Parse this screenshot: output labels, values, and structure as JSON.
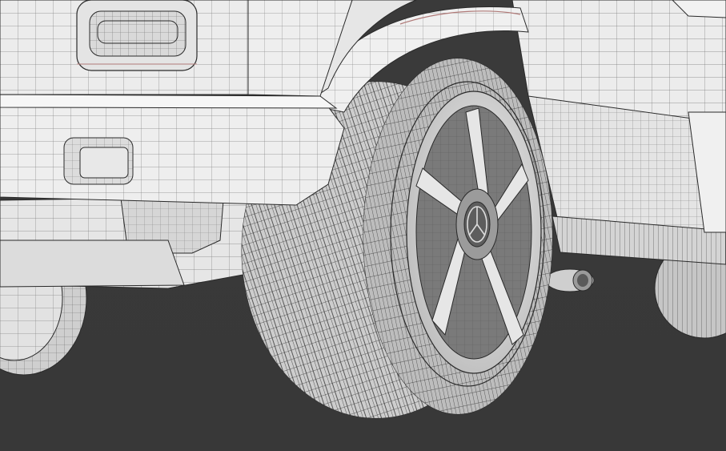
{
  "scene": {
    "subject": "suv-wireframe-rear-wheel-closeup",
    "colors": {
      "background": "#3a3a3a",
      "body": "#ececec",
      "body_shade": "#d2d2d2",
      "underbody": "#a09fa3",
      "wire": "#2a2a2a",
      "tire": "#c9c9c9",
      "tire_shade": "#9a9a9a",
      "rim": "#d8d8d8",
      "rim_dark": "#6d6d6d",
      "mesh_accent": "#b07a78"
    },
    "icons": {
      "hub_emblem": "three-pointed-star-icon"
    }
  }
}
